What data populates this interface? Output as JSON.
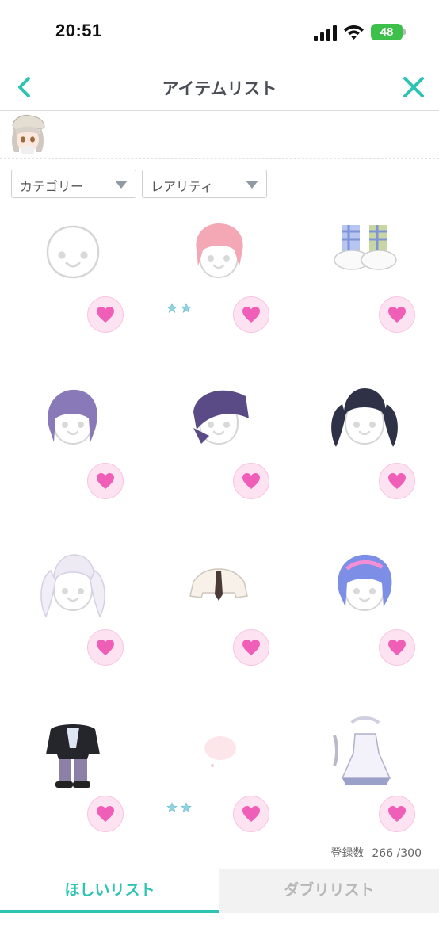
{
  "status_bar": {
    "time": "20:51",
    "battery": "48"
  },
  "header": {
    "title": "アイテムリスト",
    "back_icon": "chevron-left-icon",
    "close_icon": "close-x-icon",
    "accent": "#2fc3b3"
  },
  "filters": {
    "category_label": "カテゴリー",
    "rarity_label": "レアリティ"
  },
  "items": [
    {
      "name": "face-outline-item",
      "stars": 0
    },
    {
      "name": "pink-bob-hair-item",
      "stars": 2
    },
    {
      "name": "plaid-pants-slippers-item",
      "stars": 0
    },
    {
      "name": "purple-messy-hair-item",
      "stars": 0
    },
    {
      "name": "purple-cap-item",
      "stars": 0
    },
    {
      "name": "navy-twintail-hair-item",
      "stars": 0
    },
    {
      "name": "white-twintail-hair-item",
      "stars": 0
    },
    {
      "name": "white-shirt-tie-item",
      "stars": 0
    },
    {
      "name": "blue-pink-hair-item",
      "stars": 0
    },
    {
      "name": "black-jacket-outfit-item",
      "stars": 0
    },
    {
      "name": "pink-bubble-item",
      "stars": 2
    },
    {
      "name": "maid-dress-item",
      "stars": 0
    }
  ],
  "counter": {
    "label": "登録数",
    "value": "266 /300"
  },
  "tabs": {
    "wish_label": "ほしいリスト",
    "dup_label": "ダブリリスト"
  },
  "colors": {
    "heart": "#f05fb7",
    "heart_bg": "#fde3f1",
    "star": "#8fd3e0"
  }
}
